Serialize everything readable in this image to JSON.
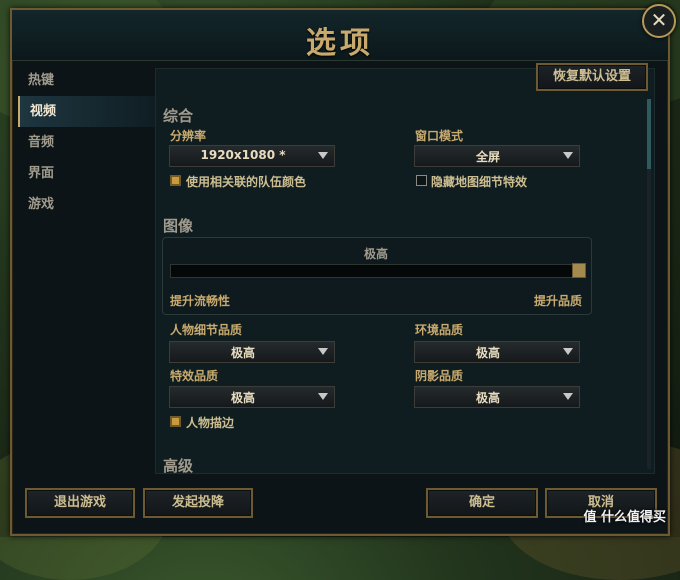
{
  "window": {
    "title": "选项",
    "close_label": "✕"
  },
  "sidebar": {
    "items": [
      {
        "label": "热键",
        "active": false
      },
      {
        "label": "视频",
        "active": true
      },
      {
        "label": "音频",
        "active": false
      },
      {
        "label": "界面",
        "active": false
      },
      {
        "label": "游戏",
        "active": false
      }
    ]
  },
  "toolbar": {
    "restore_defaults_label": "恢复默认设置"
  },
  "general": {
    "section_title": "综合",
    "resolution_label": "分辨率",
    "resolution_value": "1920x1080 *",
    "window_mode_label": "窗口模式",
    "window_mode_value": "全屏",
    "team_color_label": "使用相关联的队伍颜色",
    "team_color_checked": true,
    "hide_eyecandy_label": "隐藏地图细节特效",
    "hide_eyecandy_checked": false
  },
  "graphics": {
    "section_title": "图像",
    "preset_label": "极高",
    "preset_level": 1.0,
    "left_hint": "提升流畅性",
    "right_hint": "提升品质",
    "character_quality_label": "人物细节品质",
    "character_quality_value": "极高",
    "environment_quality_label": "环境品质",
    "environment_quality_value": "极高",
    "effects_quality_label": "特效品质",
    "effects_quality_value": "极高",
    "shadow_quality_label": "阴影品质",
    "shadow_quality_value": "极高",
    "character_outline_label": "人物描边",
    "character_outline_checked": true
  },
  "advanced": {
    "section_title": "高级"
  },
  "footer": {
    "exit_game_label": "退出游戏",
    "surrender_label": "发起投降",
    "ok_label": "确定",
    "cancel_label": "取消"
  },
  "watermark": "值 什么值得买",
  "colors": {
    "gold": "#c8aa6e",
    "panel": "#0f1c20",
    "accent_teal": "#2f5a5e"
  }
}
